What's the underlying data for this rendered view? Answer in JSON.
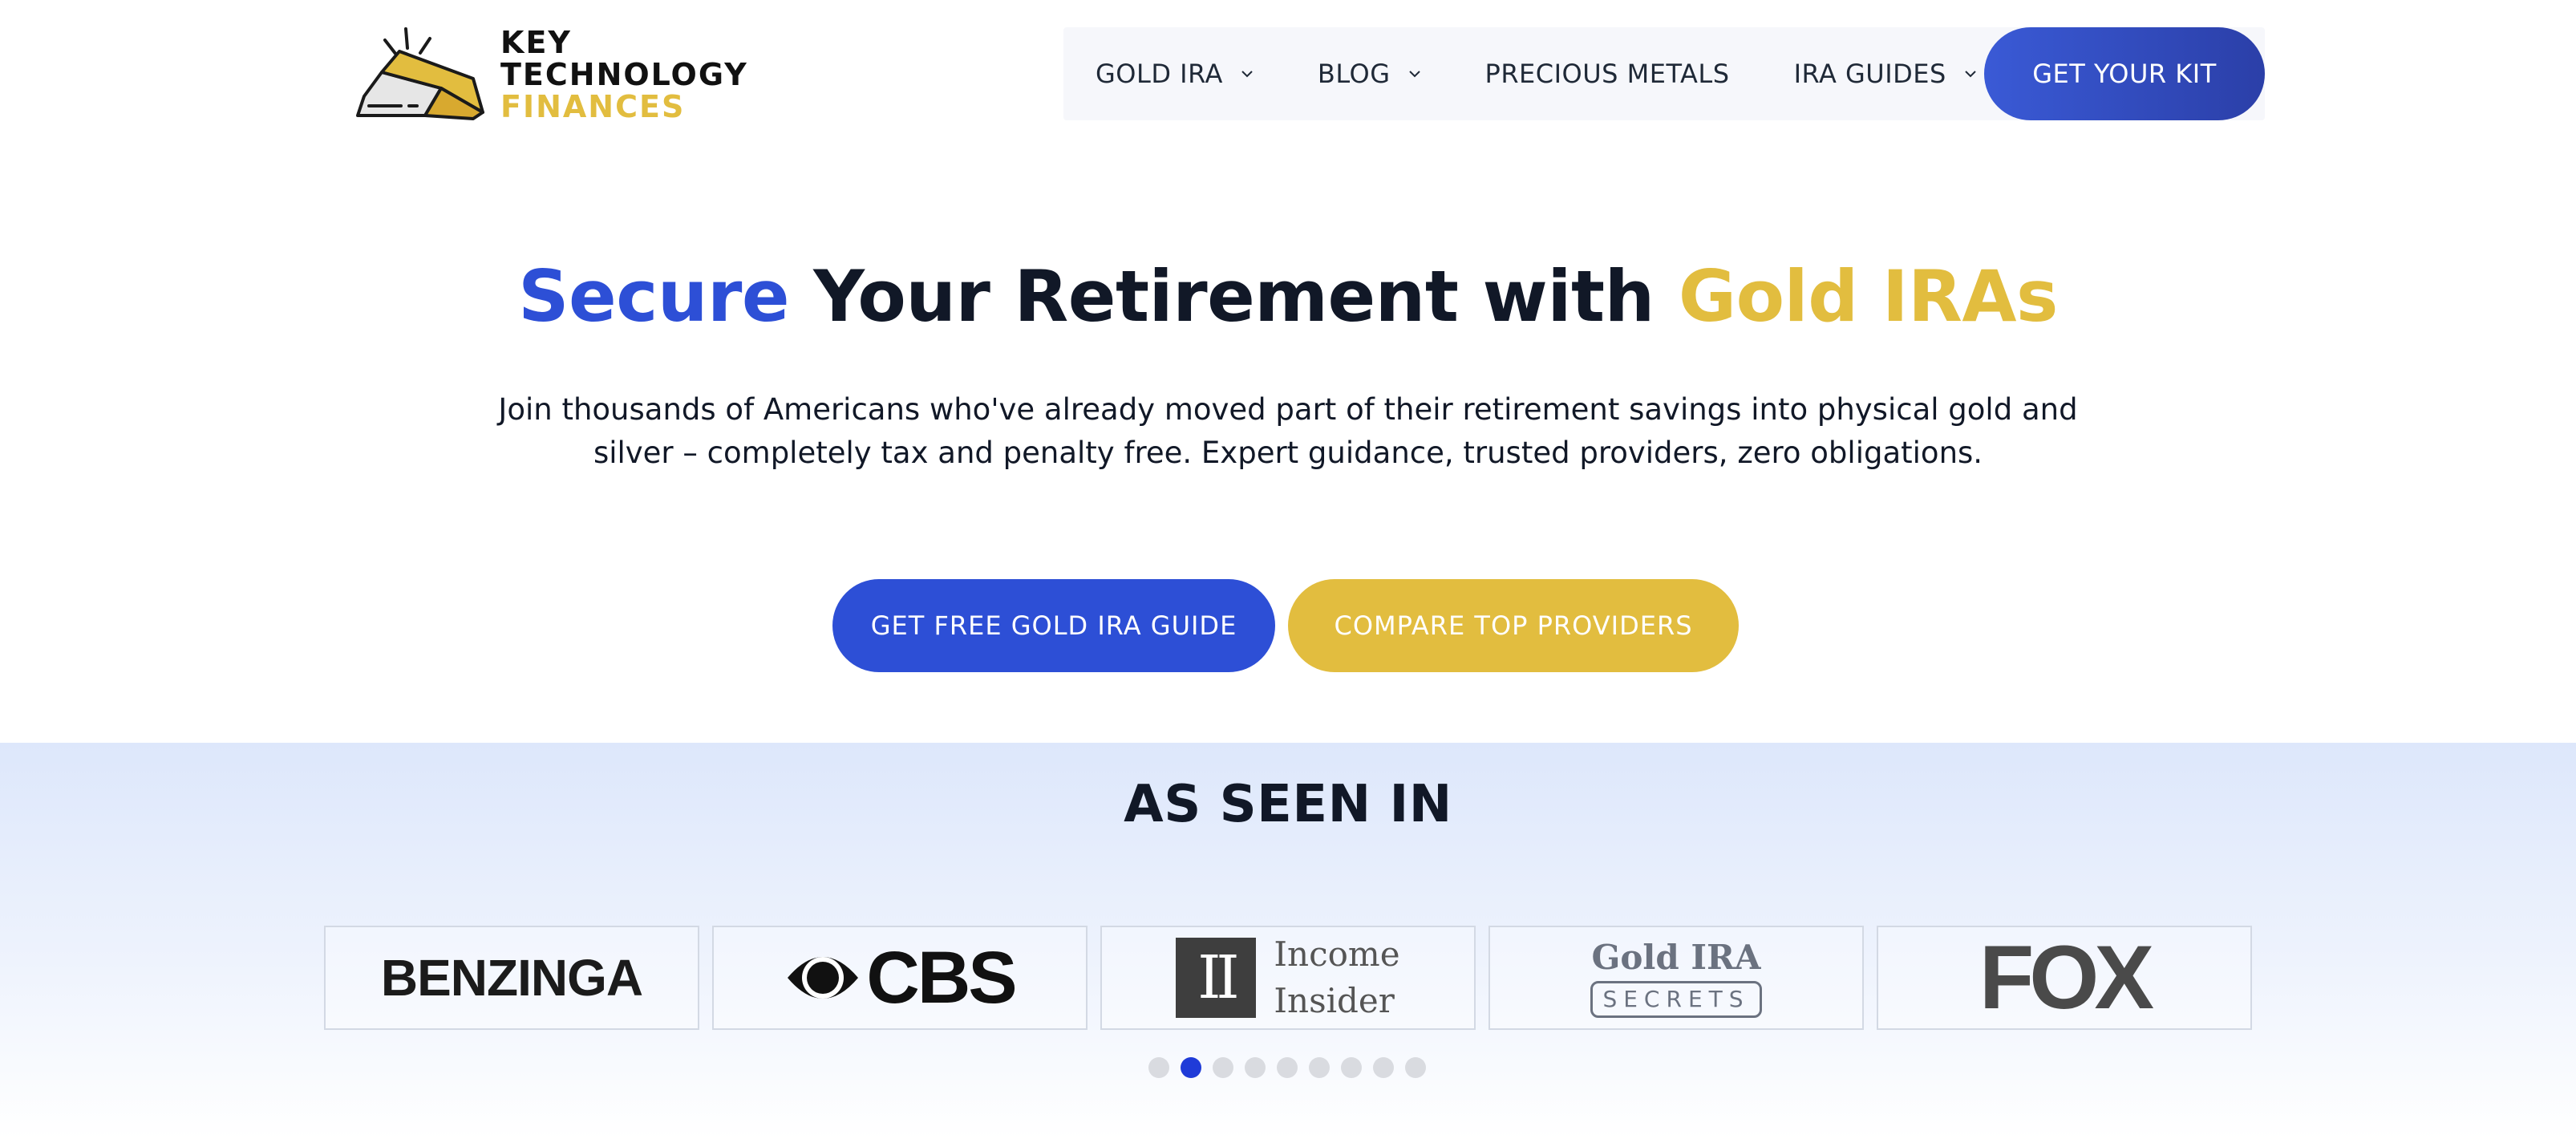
{
  "brand": {
    "line1": "KEY",
    "line2": "TECHNOLOGY",
    "line3": "FINANCES"
  },
  "nav": {
    "items": [
      {
        "label": "GOLD IRA",
        "has_dropdown": true
      },
      {
        "label": "BLOG",
        "has_dropdown": true
      },
      {
        "label": "PRECIOUS METALS",
        "has_dropdown": false
      },
      {
        "label": "IRA GUIDES",
        "has_dropdown": true
      }
    ],
    "cta_label": "GET YOUR KIT"
  },
  "hero": {
    "title_part1": "Secure",
    "title_part2": " Your Retirement with ",
    "title_part3": "Gold IRAs",
    "subtitle_line1": "Join thousands of Americans who've already moved part of their retirement savings into physical gold and",
    "subtitle_line2": "silver – completely tax and penalty free. Expert guidance, trusted providers, zero obligations.",
    "primary_button": "GET FREE GOLD IRA GUIDE",
    "secondary_button": "COMPARE TOP PROVIDERS"
  },
  "as_seen_in": {
    "title": "AS SEEN IN",
    "logos": {
      "benzinga": "BENZINGA",
      "cbs": "CBS",
      "income_line1": "Income",
      "income_line2": "Insider",
      "income_mark": "II",
      "secrets_top": "Gold IRA",
      "secrets_bottom": "SECRETS",
      "fox": "FOX"
    },
    "carousel": {
      "total": 9,
      "active_index": 1
    }
  },
  "colors": {
    "accent_blue": "#2d4fd6",
    "accent_gold": "#e2bd3f",
    "text_dark": "#111827"
  }
}
